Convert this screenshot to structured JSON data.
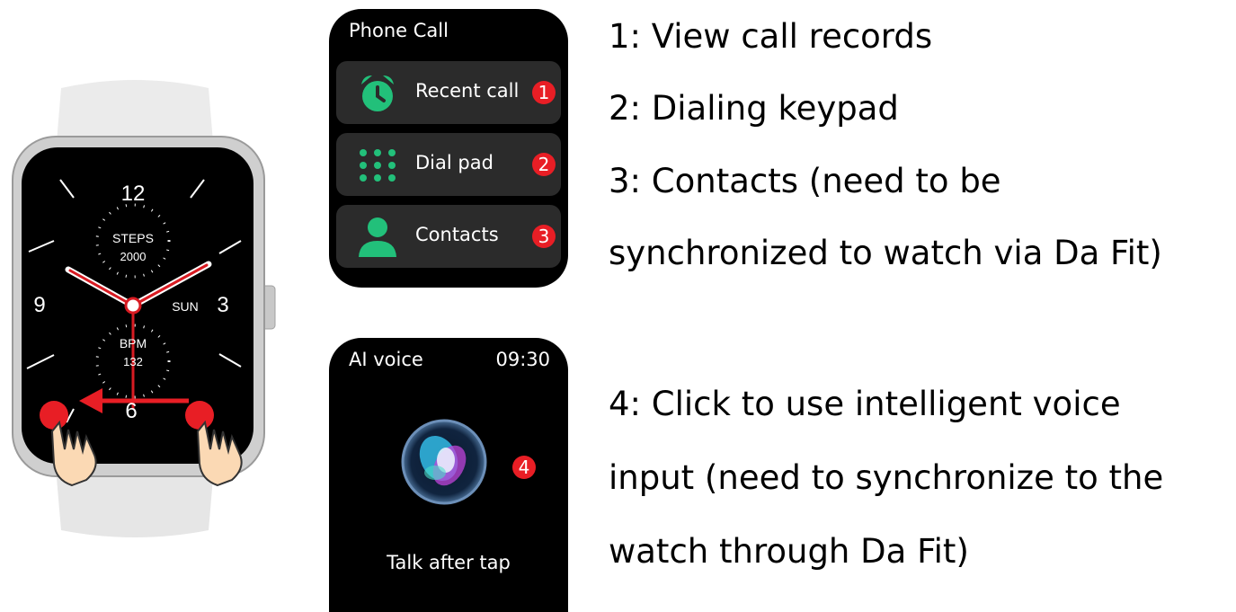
{
  "watch_face": {
    "hour_12": "12",
    "hour_9": "9",
    "hour_3": "3",
    "hour_6": "6",
    "steps_label": "STEPS",
    "steps_value": "2000",
    "day": "SUN",
    "bpm_label": "BPM",
    "bpm_value": "132"
  },
  "phone_screen": {
    "title": "Phone Call",
    "items": [
      {
        "label": "Recent call",
        "badge": "1",
        "icon": "alarm-clock-icon"
      },
      {
        "label": "Dial pad",
        "badge": "2",
        "icon": "dial-pad-icon"
      },
      {
        "label": "Contacts",
        "badge": "3",
        "icon": "contact-person-icon"
      }
    ]
  },
  "ai_screen": {
    "title": "AI voice",
    "time": "09:30",
    "badge": "4",
    "hint": "Talk after tap"
  },
  "descriptions": {
    "line1": "1: View call records",
    "line2": "2: Dialing keypad",
    "line3a": "3: Contacts (need to be",
    "line3b": "synchronized to watch via Da Fit)",
    "line4a": "4: Click to use intelligent voice",
    "line4b": "input (need to synchronize to the",
    "line4c": "watch through Da Fit)"
  },
  "colors": {
    "badge": "#e81e25",
    "icon_green": "#22c07a",
    "menu_bg": "#2b2b2b",
    "swipe_arrow": "#e81e25"
  }
}
